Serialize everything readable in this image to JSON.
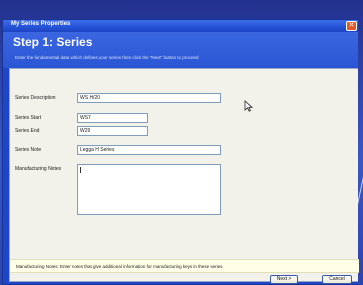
{
  "window": {
    "title": "My Series Properties",
    "close_symbol": "✕"
  },
  "banner": {
    "step_title": "Step 1: Series",
    "description": "Enter the fundamental data which defines your series then click the \"Next\" button to proceed"
  },
  "form": {
    "series_description_label": "Series Description",
    "series_description_value": "WS H/20",
    "series_start_label": "Series Start",
    "series_start_value": "WS7",
    "series_end_label": "Series End",
    "series_end_value": "W29",
    "series_note_label": "Series Note",
    "series_note_value": "Legga H Series",
    "manufacturing_notes_label": "Manufacturing Notes",
    "manufacturing_notes_value": ""
  },
  "hint": {
    "text": "Manufacturing Notes: Enter notes that give additional information for manufacturing keys in these series."
  },
  "buttons": {
    "next_label": "Next >",
    "cancel_label": "Cancel"
  },
  "icons": {
    "cursor": "pointer-cursor-icon",
    "close": "close-icon"
  }
}
